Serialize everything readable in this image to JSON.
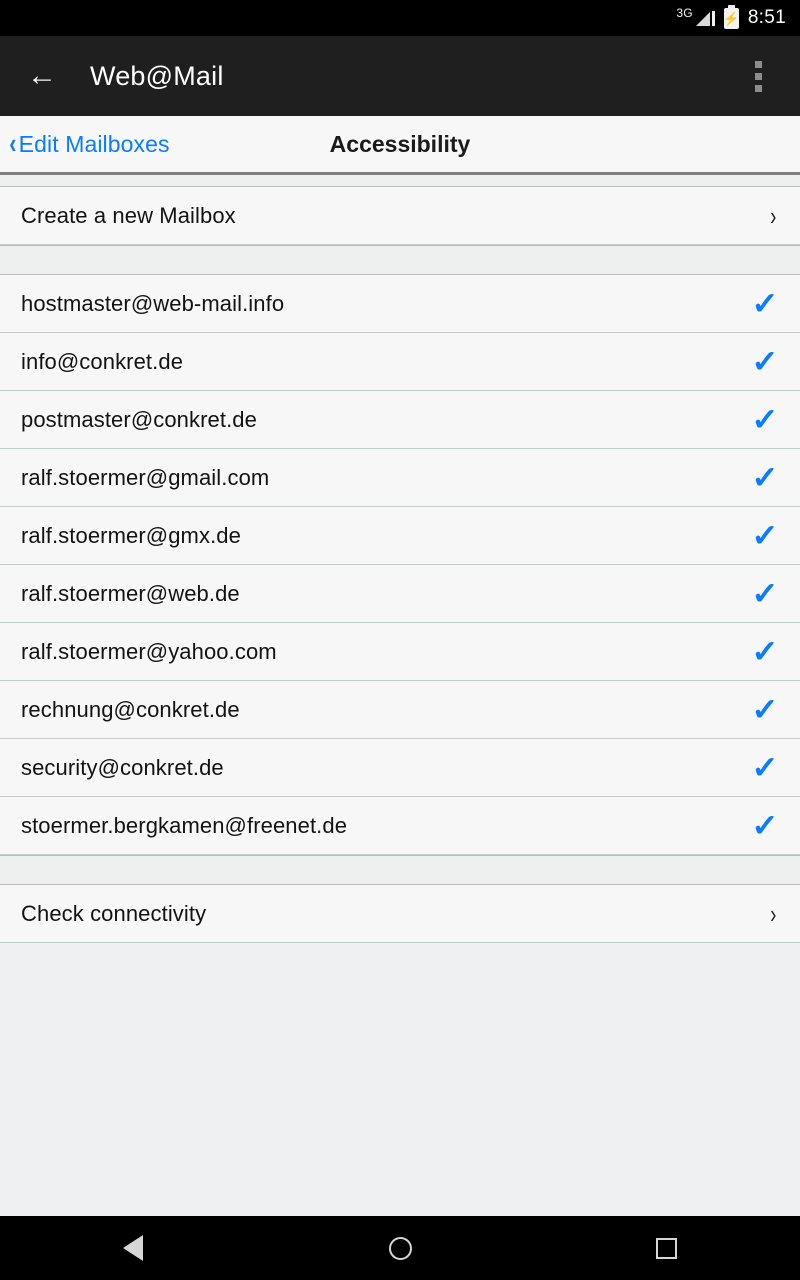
{
  "status_bar": {
    "network_type": "3G",
    "signal_icon": "signal-bars-icon",
    "battery_icon": "battery-charging-icon",
    "time": "8:51"
  },
  "app_bar": {
    "back_icon": "back-arrow-icon",
    "title": "Web@Mail",
    "overflow_icon": "overflow-menu-icon"
  },
  "nav_header": {
    "back_chevron": "‹",
    "back_label": "Edit Mailboxes",
    "title": "Accessibility"
  },
  "sections": {
    "create": {
      "label": "Create a new Mailbox",
      "chevron": "›"
    },
    "mailboxes": [
      {
        "email": "hostmaster@web-mail.info",
        "checked": true
      },
      {
        "email": "info@conkret.de",
        "checked": true
      },
      {
        "email": "postmaster@conkret.de",
        "checked": true
      },
      {
        "email": "ralf.stoermer@gmail.com",
        "checked": true
      },
      {
        "email": "ralf.stoermer@gmx.de",
        "checked": true
      },
      {
        "email": "ralf.stoermer@web.de",
        "checked": true
      },
      {
        "email": "ralf.stoermer@yahoo.com",
        "checked": true
      },
      {
        "email": "rechnung@conkret.de",
        "checked": true
      },
      {
        "email": "security@conkret.de",
        "checked": true
      },
      {
        "email": "stoermer.bergkamen@freenet.de",
        "checked": true
      }
    ],
    "connectivity": {
      "label": "Check connectivity",
      "chevron": "›"
    }
  },
  "check_glyph": "✓",
  "nav_bar": {
    "back_icon": "nav-back-icon",
    "home_icon": "nav-home-icon",
    "recents_icon": "nav-recents-icon"
  },
  "colors": {
    "accent_blue": "#0a7cff",
    "app_bar": "#1f1f1f",
    "row_bg": "#f7f7f7",
    "page_bg": "#eff0f1"
  }
}
